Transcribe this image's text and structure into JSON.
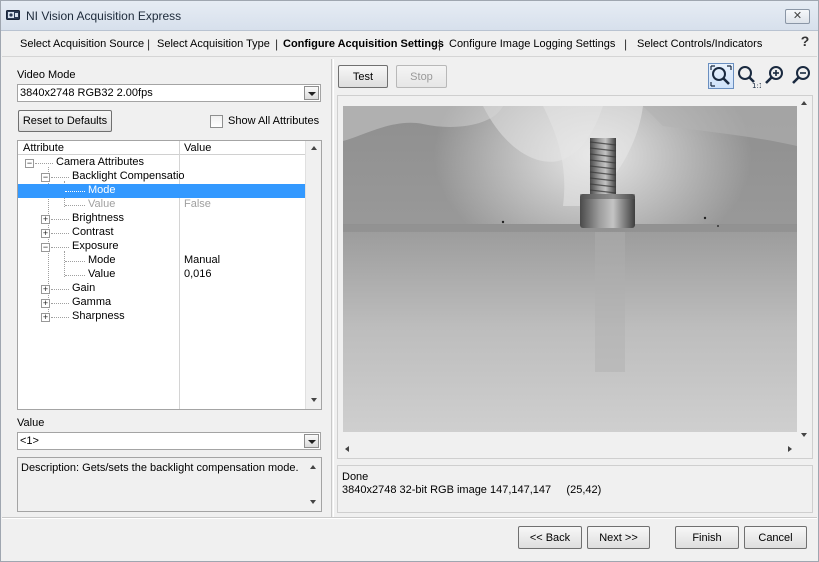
{
  "window": {
    "title": "NI Vision Acquisition Express"
  },
  "steps": [
    {
      "label": "Select Acquisition Source"
    },
    {
      "label": "Select Acquisition Type"
    },
    {
      "label": "Configure Acquisition Settings"
    },
    {
      "label": "Configure Image Logging Settings"
    },
    {
      "label": "Select Controls/Indicators"
    }
  ],
  "help": "?",
  "left": {
    "video_mode_label": "Video Mode",
    "video_mode_value": "3840x2748 RGB32 2.00fps",
    "reset_button": "Reset to Defaults",
    "show_all_label": "Show All Attributes",
    "columns": {
      "attribute": "Attribute",
      "value": "Value"
    },
    "tree": [
      {
        "name": "Camera Attributes",
        "value": "",
        "expander": "−"
      },
      {
        "name": "Backlight Compensatio",
        "value": "",
        "expander": "−"
      },
      {
        "name": "Mode",
        "value": "",
        "expander": ""
      },
      {
        "name": "Value",
        "value": "False",
        "expander": ""
      },
      {
        "name": "Brightness",
        "value": "",
        "expander": "+"
      },
      {
        "name": "Contrast",
        "value": "",
        "expander": "+"
      },
      {
        "name": "Exposure",
        "value": "",
        "expander": "−"
      },
      {
        "name": "Mode",
        "value": "Manual",
        "expander": ""
      },
      {
        "name": "Value",
        "value": "0,016",
        "expander": ""
      },
      {
        "name": "Gain",
        "value": "",
        "expander": "+"
      },
      {
        "name": "Gamma",
        "value": "",
        "expander": "+"
      },
      {
        "name": "Sharpness",
        "value": "",
        "expander": "+"
      }
    ],
    "value_label": "Value",
    "value_combo": "<1>",
    "description": "Description: Gets/sets the backlight compensation mode."
  },
  "right": {
    "test_button": "Test",
    "stop_button": "Stop",
    "status_line1": "Done",
    "status_line2": "3840x2748 32-bit RGB image 147,147,147     (25,42)"
  },
  "footer": {
    "back": "<< Back",
    "next": "Next >>",
    "finish": "Finish",
    "cancel": "Cancel"
  }
}
